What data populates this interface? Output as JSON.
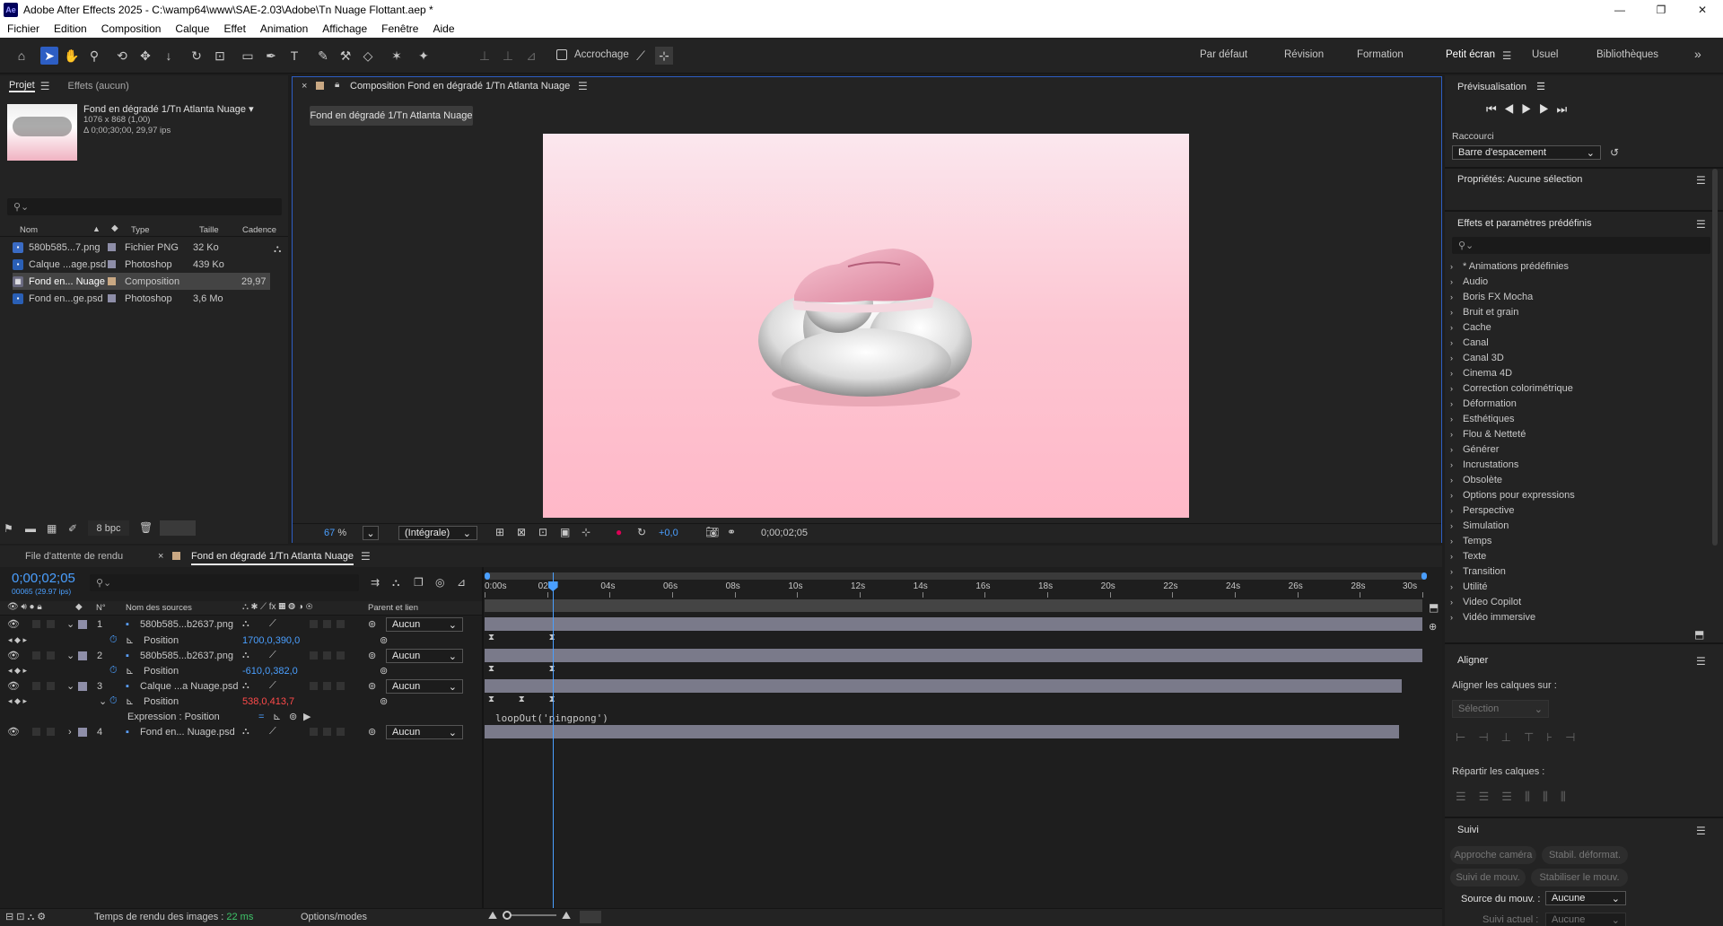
{
  "window": {
    "title": "Adobe After Effects 2025 - C:\\wamp64\\www\\SAE-2.03\\Adobe\\Tn Nuage Flottant.aep *",
    "app_badge": "Ae"
  },
  "menu": [
    "Fichier",
    "Edition",
    "Composition",
    "Calque",
    "Effet",
    "Animation",
    "Affichage",
    "Fenêtre",
    "Aide"
  ],
  "toolbar": {
    "snap_label": "Accrochage",
    "workspaces": [
      "Par défaut",
      "Révision",
      "Formation",
      "Petit écran",
      "Usuel",
      "Bibliothèques"
    ],
    "active_workspace": "Petit écran",
    "more": "»"
  },
  "project": {
    "tabs": [
      "Projet",
      "Effets (aucun)"
    ],
    "selected_name": "Fond en dégradé 1/Tn Atlanta Nuage",
    "selected_dims": "1076 x 868 (1,00)",
    "selected_duration": "Δ 0;00;30;00, 29,97 ips",
    "columns": [
      "Nom",
      "Type",
      "Taille",
      "Cadence"
    ],
    "items": [
      {
        "name": "580b585...7.png",
        "type": "Fichier PNG",
        "size": "32 Ko",
        "rate": "",
        "color": "#8e8ea8"
      },
      {
        "name": "Calque ...age.psd",
        "type": "Photoshop",
        "size": "439 Ko",
        "rate": "",
        "color": "#8e8ea8"
      },
      {
        "name": "Fond en... Nuage",
        "type": "Composition",
        "size": "",
        "rate": "29,97",
        "color": "#c9a883"
      },
      {
        "name": "Fond en...ge.psd",
        "type": "Photoshop",
        "size": "3,6 Mo",
        "rate": "",
        "color": "#8e8ea8"
      }
    ],
    "bpc": "8 bpc"
  },
  "composition": {
    "tab_title": "Composition Fond en dégradé 1/Tn Atlanta Nuage",
    "flow_tab": "Fond en dégradé 1/Tn Atlanta Nuage",
    "zoom": "67",
    "zoom_unit": "%",
    "resolution": "(Intégrale)",
    "exposure": "+0,0",
    "timecode": "0;00;02;05"
  },
  "timeline": {
    "tabs": [
      "File d'attente de rendu",
      "Fond en dégradé 1/Tn Atlanta Nuage"
    ],
    "timecode": "0;00;02;05",
    "frames": "00065 (29.97 ips)",
    "col_num": "N°",
    "col_source": "Nom des sources",
    "col_parent": "Parent et lien",
    "ruler": [
      "0:00s",
      "02s",
      "04s",
      "06s",
      "08s",
      "10s",
      "12s",
      "14s",
      "16s",
      "18s",
      "20s",
      "22s",
      "24s",
      "26s",
      "28s",
      "30s"
    ],
    "current_time_s": 2.17,
    "duration_s": 30,
    "layers": [
      {
        "num": "1",
        "name": "580b585...b2637.png",
        "parent": "Aucun",
        "prop": "Position",
        "value": "1700,0,390,0",
        "value_color": "blue",
        "track_end": 1.0
      },
      {
        "num": "2",
        "name": "580b585...b2637.png",
        "parent": "Aucun",
        "prop": "Position",
        "value": "-610,0,382,0",
        "value_color": "blue",
        "track_end": 1.0
      },
      {
        "num": "3",
        "name": "Calque ...a Nuage.psd",
        "parent": "Aucun",
        "prop": "Position",
        "value": "538,0,413,7",
        "value_color": "red",
        "expr_label": "Expression : Position",
        "expr": "loopOut('pingpong')",
        "track_end": 0.978
      },
      {
        "num": "4",
        "name": "Fond en... Nuage.psd",
        "parent": "Aucun",
        "track_end": 0.975
      }
    ],
    "footer_render": "Temps de rendu des images :",
    "footer_render_value": "22 ms",
    "footer_modes": "Options/modes"
  },
  "preview": {
    "title": "Prévisualisation",
    "shortcut_label": "Raccourci",
    "shortcut_value": "Barre d'espacement"
  },
  "properties": {
    "title": "Propriétés: Aucune sélection"
  },
  "effects": {
    "title": "Effets et paramètres prédéfinis",
    "items": [
      "* Animations prédéfinies",
      "Audio",
      "Boris FX Mocha",
      "Bruit et grain",
      "Cache",
      "Canal",
      "Canal 3D",
      "Cinema 4D",
      "Correction colorimétrique",
      "Déformation",
      "Esthétiques",
      "Flou & Netteté",
      "Générer",
      "Incrustations",
      "Obsolète",
      "Options pour expressions",
      "Perspective",
      "Simulation",
      "Temps",
      "Texte",
      "Transition",
      "Utilité",
      "Video Copilot",
      "Vidéo immersive"
    ]
  },
  "align": {
    "title": "Aligner",
    "align_to_label": "Aligner les calques sur :",
    "align_to_value": "Sélection",
    "distribute_label": "Répartir les calques :"
  },
  "tracker": {
    "title": "Suivi",
    "buttons": [
      "Approche caméra",
      "Stabil. déformat.",
      "Suivi de mouv.",
      "Stabiliser le mouv."
    ],
    "source_label": "Source du mouv. :",
    "source_value": "Aucune",
    "current_label": "Suivi actuel :",
    "current_value": "Aucune"
  }
}
